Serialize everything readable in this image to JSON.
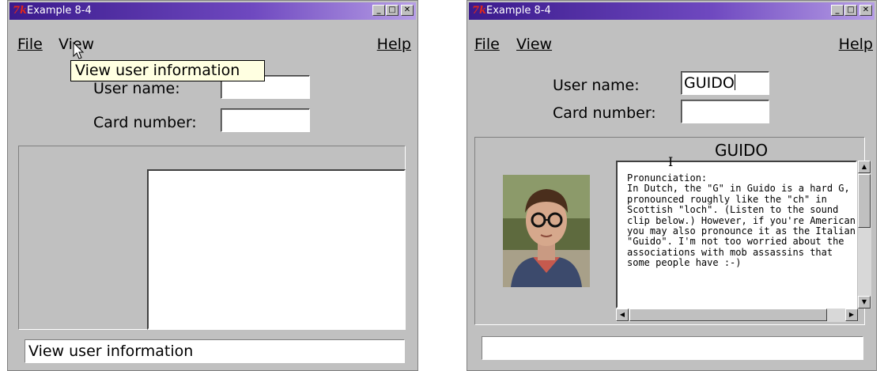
{
  "left_window": {
    "title": "Example 8-4",
    "menu": {
      "file": "File",
      "view": "View",
      "help": "Help"
    },
    "tooltip": "View user information",
    "form": {
      "user_name_label": "User name:",
      "user_name_value": "",
      "card_number_label": "Card number:",
      "card_number_value": ""
    },
    "status_text": "View user information"
  },
  "right_window": {
    "title": "Example 8-4",
    "menu": {
      "file": "File",
      "view": "View",
      "help": "Help"
    },
    "form": {
      "user_name_label": "User name:",
      "user_name_value": "GUIDO",
      "card_number_label": "Card number:",
      "card_number_value": ""
    },
    "info_heading": "GUIDO",
    "pronunciation_text": "Pronunciation:\nIn Dutch, the \"G\" in Guido is a hard G,\npronounced roughly like the \"ch\" in\nScottish \"loch\". (Listen to the sound\nclip below.) However, if you're American\nyou may also pronounce it as the Italian\n\"Guido\". I'm not too worried about the\nassociations with mob assassins that\nsome people have :-)",
    "status_text": ""
  },
  "window_buttons": {
    "minimize": "_",
    "maximize": "□",
    "close": "✕"
  },
  "icons": [
    "tk-icon",
    "arrow-cursor-icon",
    "ibeam-cursor-icon",
    "scroll-up-icon",
    "scroll-down-icon",
    "scroll-left-icon",
    "scroll-right-icon"
  ],
  "colors": {
    "window_bg": "#c0c0c0",
    "tooltip_bg": "#ffffe1",
    "titlebar": "#3a1a8c"
  }
}
